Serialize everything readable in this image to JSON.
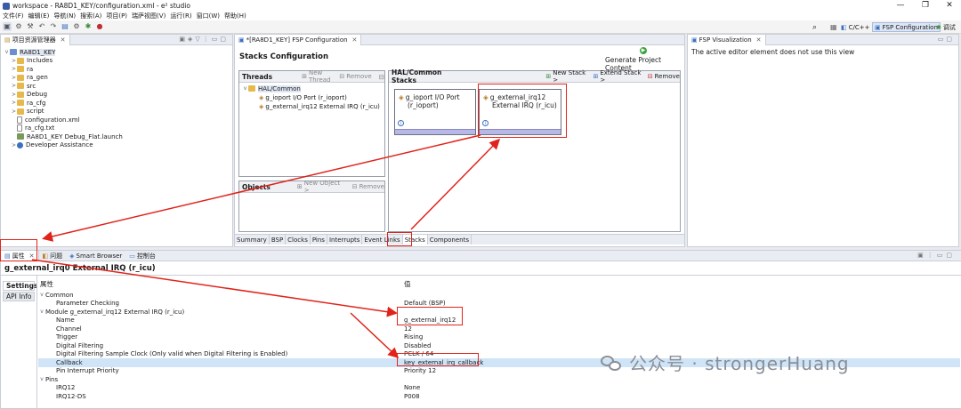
{
  "window": {
    "title": "workspace - RA8D1_KEY/configuration.xml - e² studio",
    "controls": [
      "—",
      "❐",
      "✕"
    ]
  },
  "menu": [
    "文件(F)",
    "编辑(E)",
    "导航(N)",
    "搜索(A)",
    "项目(P)",
    "瑞萨视图(V)",
    "运行(R)",
    "窗口(W)",
    "帮助(H)"
  ],
  "perspectives": {
    "cc": "C/C++",
    "fsp": "FSP Configuration",
    "debug": "调试"
  },
  "explorer": {
    "tab": "项目资源管理器",
    "items": [
      {
        "label": "RA8D1_KEY",
        "indent": 0,
        "icon": "proj",
        "twisty": "v"
      },
      {
        "label": "Includes",
        "indent": 1,
        "icon": "folder",
        "twisty": ">"
      },
      {
        "label": "ra",
        "indent": 1,
        "icon": "folder",
        "twisty": ">"
      },
      {
        "label": "ra_gen",
        "indent": 1,
        "icon": "folder",
        "twisty": ">"
      },
      {
        "label": "src",
        "indent": 1,
        "icon": "folder",
        "twisty": ">"
      },
      {
        "label": "Debug",
        "indent": 1,
        "icon": "folder",
        "twisty": ">"
      },
      {
        "label": "ra_cfg",
        "indent": 1,
        "icon": "folder",
        "twisty": ">"
      },
      {
        "label": "script",
        "indent": 1,
        "icon": "folder",
        "twisty": ">"
      },
      {
        "label": "configuration.xml",
        "indent": 1,
        "icon": "file",
        "twisty": ""
      },
      {
        "label": "ra_cfg.txt",
        "indent": 1,
        "icon": "file",
        "twisty": ""
      },
      {
        "label": "RA8D1_KEY Debug_Flat.launch",
        "indent": 1,
        "icon": "launch",
        "twisty": ""
      },
      {
        "label": "Developer Assistance",
        "indent": 1,
        "icon": "help",
        "twisty": ">"
      }
    ]
  },
  "fsp": {
    "tab": "*[RA8D1_KEY] FSP Configuration",
    "heading": "Stacks Configuration",
    "generate": "Generate Project Content",
    "threads": {
      "title": "Threads",
      "new_thread": "New Thread",
      "remove": "Remove",
      "tree": [
        "HAL/Common",
        "g_ioport I/O Port (r_ioport)",
        "g_external_irq12 External IRQ (r_icu)"
      ]
    },
    "objects": {
      "title": "Objects",
      "new_object": "New Object >",
      "remove": "Remove"
    },
    "hal": {
      "title": "HAL/Common Stacks",
      "new_stack": "New Stack >",
      "extend_stack": "Extend Stack >",
      "remove": "Remove",
      "cards": [
        {
          "line1": "g_ioport I/O Port",
          "line2": "(r_ioport)"
        },
        {
          "line1": "g_external_irq12",
          "line2": "External IRQ (r_icu)"
        }
      ]
    },
    "bottom_tabs": [
      "Summary",
      "BSP",
      "Clocks",
      "Pins",
      "Interrupts",
      "Event Links",
      "Stacks",
      "Components"
    ]
  },
  "viz": {
    "tab": "FSP Visualization",
    "message": "The active editor element does not use this view"
  },
  "props": {
    "tabs": [
      "属性",
      "问题",
      "Smart Browser",
      "控制台"
    ],
    "title": "g_external_irq0 External IRQ (r_icu)",
    "side_tabs": [
      "Settings",
      "API Info"
    ],
    "col_prop": "属性",
    "col_val": "值",
    "rows": [
      {
        "label": "Common",
        "value": "",
        "indent": 0,
        "twisty": "v"
      },
      {
        "label": "Parameter Checking",
        "value": "Default (BSP)",
        "indent": 2,
        "twisty": ""
      },
      {
        "label": "Module g_external_irq12 External IRQ (r_icu)",
        "value": "",
        "indent": 0,
        "twisty": "v"
      },
      {
        "label": "Name",
        "value": "g_external_irq12",
        "indent": 2,
        "twisty": ""
      },
      {
        "label": "Channel",
        "value": "12",
        "indent": 2,
        "twisty": ""
      },
      {
        "label": "Trigger",
        "value": "Rising",
        "indent": 2,
        "twisty": ""
      },
      {
        "label": "Digital Filtering",
        "value": "Disabled",
        "indent": 2,
        "twisty": ""
      },
      {
        "label": "Digital Filtering Sample Clock (Only valid when Digital Filtering is Enabled)",
        "value": "PCLK / 64",
        "indent": 2,
        "twisty": ""
      },
      {
        "label": "Callback",
        "value": "key_external_irq_callback",
        "indent": 2,
        "twisty": ""
      },
      {
        "label": "Pin Interrupt Priority",
        "value": "Priority 12",
        "indent": 2,
        "twisty": ""
      },
      {
        "label": "Pins",
        "value": "",
        "indent": 0,
        "twisty": "v"
      },
      {
        "label": "IRQ12",
        "value": "None",
        "indent": 2,
        "twisty": ""
      },
      {
        "label": "IRQ12-DS",
        "value": "P008",
        "indent": 2,
        "twisty": ""
      }
    ]
  },
  "watermark": "公众号 · strongerHuang",
  "colors": {
    "annotation": "#e0241b",
    "selection": "#cfe4f7",
    "card_band": "#b7b7e8"
  }
}
